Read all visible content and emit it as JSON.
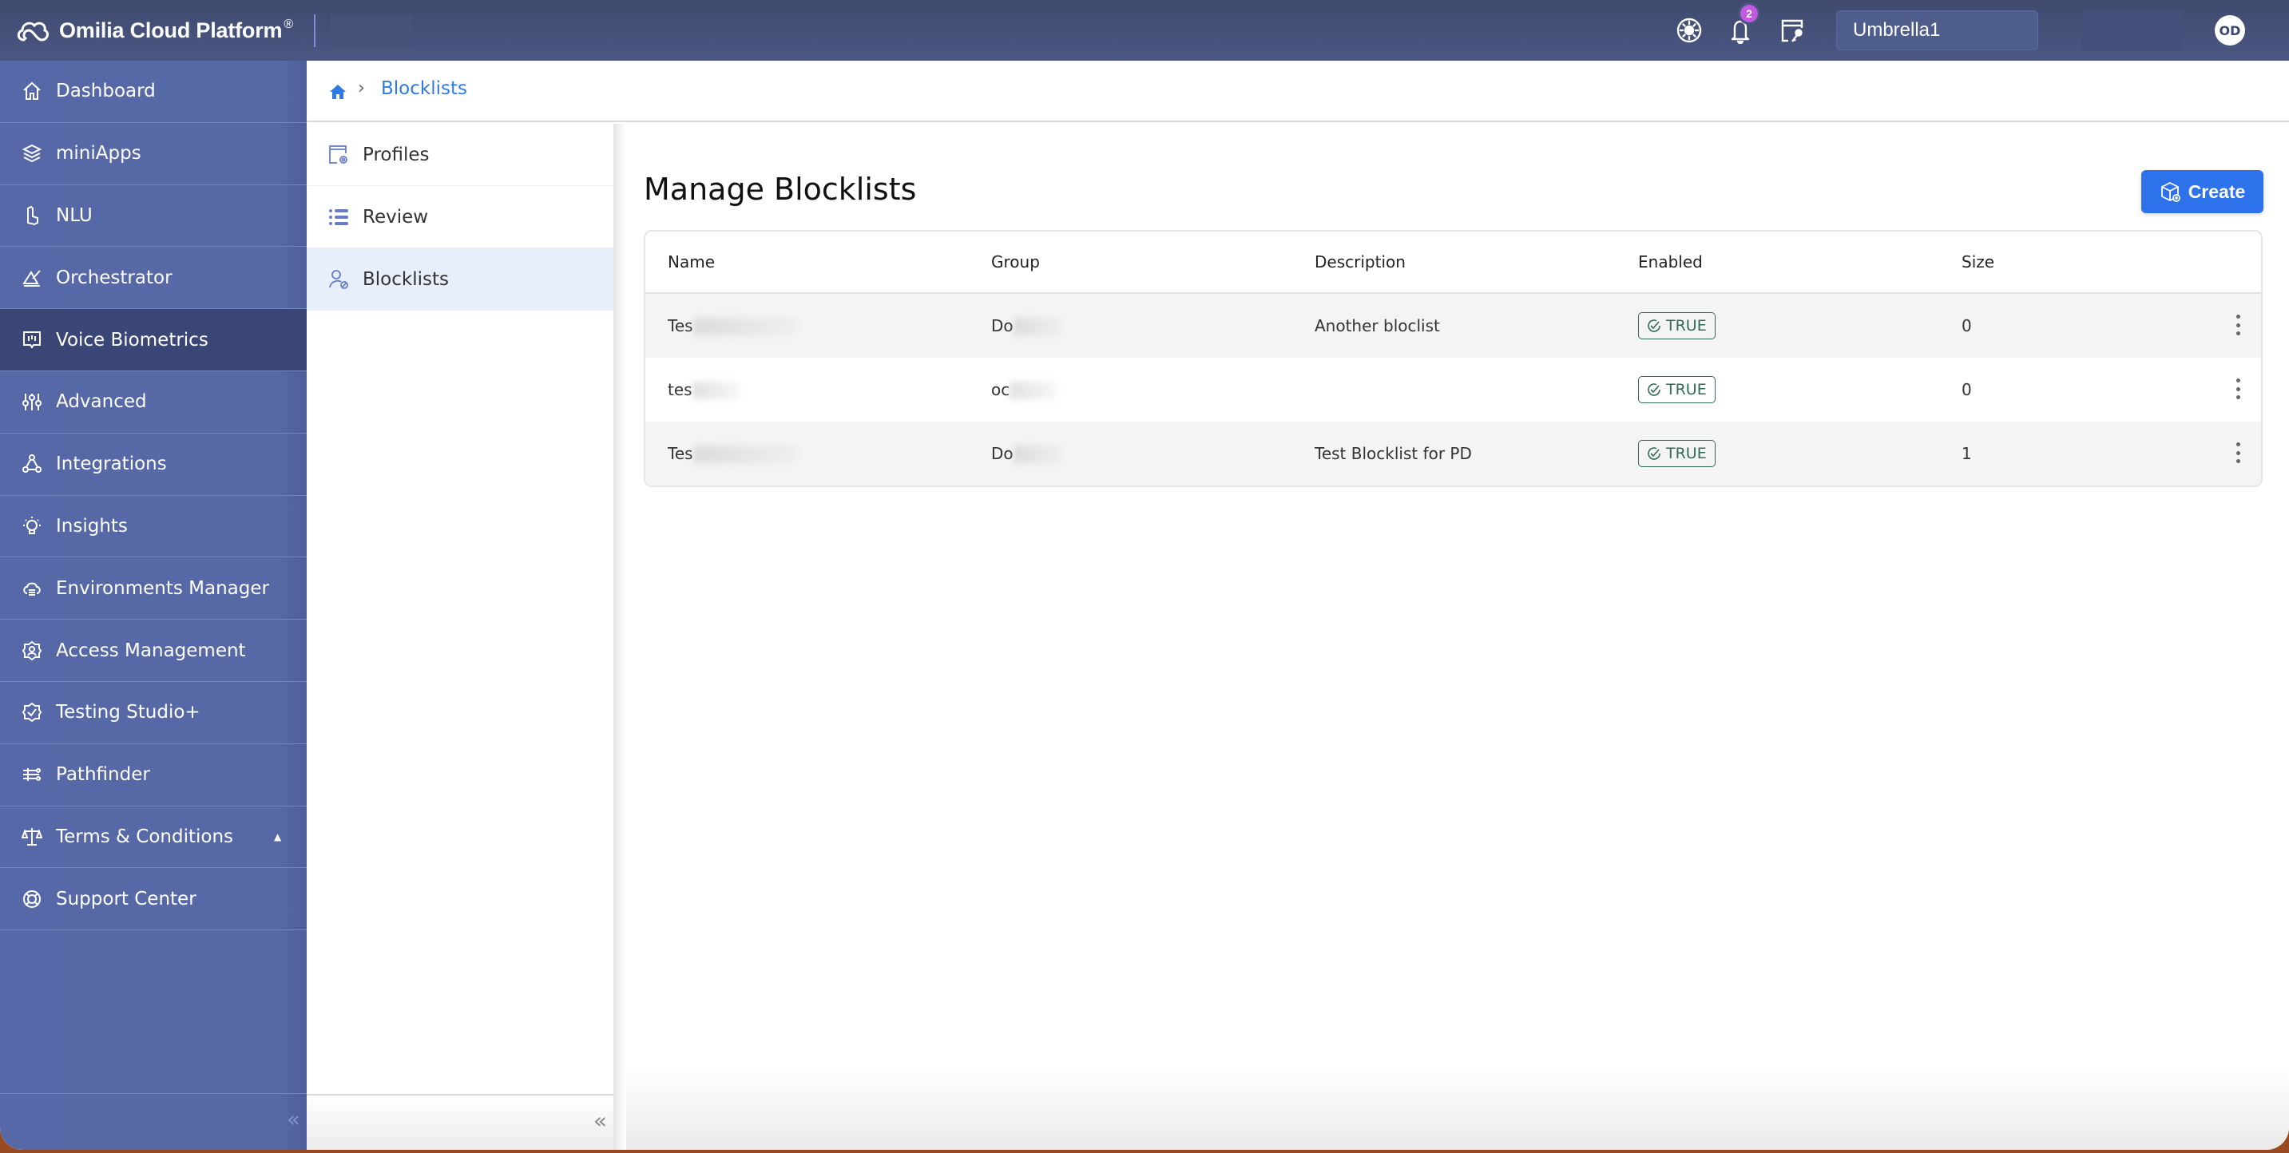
{
  "topbar": {
    "app_title": "Omilia Cloud Platform",
    "registered_mark": "®",
    "notification_count": "2",
    "tenant": "Umbrella1",
    "avatar_initials": "OD",
    "icons": [
      "theme-icon",
      "bell-icon",
      "license-key-icon"
    ]
  },
  "sidebar": {
    "items": [
      {
        "label": "Dashboard",
        "icon": "home-icon"
      },
      {
        "label": "miniApps",
        "icon": "layers-icon"
      },
      {
        "label": "NLU",
        "icon": "nlu-icon"
      },
      {
        "label": "Orchestrator",
        "icon": "orchestrator-icon"
      },
      {
        "label": "Voice Biometrics",
        "icon": "voice-biometrics-icon",
        "active": true
      },
      {
        "label": "Advanced",
        "icon": "sliders-icon"
      },
      {
        "label": "Integrations",
        "icon": "integrations-icon"
      },
      {
        "label": "Insights",
        "icon": "lightbulb-icon"
      },
      {
        "label": "Environments Manager",
        "icon": "cloud-server-icon"
      },
      {
        "label": "Access Management",
        "icon": "user-gear-icon"
      },
      {
        "label": "Testing Studio+",
        "icon": "badge-check-icon"
      },
      {
        "label": "Pathfinder",
        "icon": "pathfinder-icon"
      },
      {
        "label": "Terms & Conditions",
        "icon": "scale-icon",
        "caret": "▲"
      },
      {
        "label": "Support Center",
        "icon": "lifebuoy-icon"
      }
    ],
    "collapse_glyph": "«"
  },
  "breadcrumb": {
    "current": "Blocklists",
    "separator": "›"
  },
  "subnav": {
    "items": [
      {
        "label": "Profiles",
        "icon": "profiles-icon"
      },
      {
        "label": "Review",
        "icon": "list-icon"
      },
      {
        "label": "Blocklists",
        "icon": "user-block-icon",
        "active": true
      }
    ],
    "collapse_glyph": "«"
  },
  "main": {
    "title": "Manage Blocklists",
    "create_label": "Create",
    "table": {
      "columns": [
        "Name",
        "Group",
        "Description",
        "Enabled",
        "Size"
      ],
      "rows": [
        {
          "name": "Tes",
          "group": "Do",
          "description": "Another bloclist",
          "enabled": "TRUE",
          "size": "0"
        },
        {
          "name": "tes",
          "group": "oc",
          "description": "",
          "enabled": "TRUE",
          "size": "0"
        },
        {
          "name": "Tes",
          "group": "Do",
          "description": "Test Blocklist for PD",
          "enabled": "TRUE",
          "size": "1"
        }
      ]
    }
  },
  "colors": {
    "topbar": "#434e75",
    "sidebar": "#5668a7",
    "sidebar_active": "#3a4676",
    "accent": "#2d72ea",
    "enabled_pill": "#2f6b55",
    "notification_badge": "#c359e0"
  }
}
